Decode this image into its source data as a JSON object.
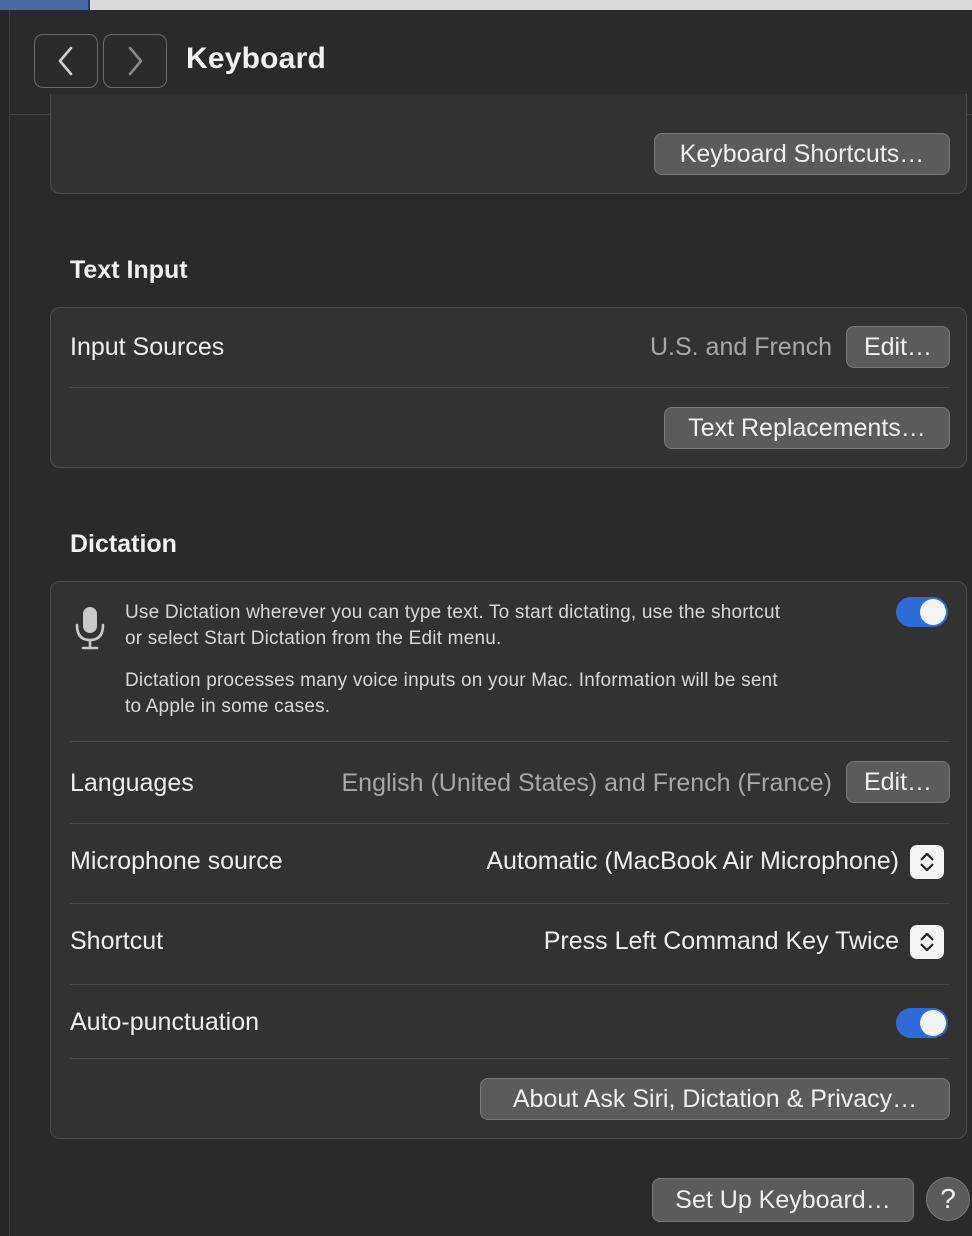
{
  "window": {
    "title": "Keyboard"
  },
  "keyboard_section": {
    "shortcuts_button": "Keyboard Shortcuts…"
  },
  "text_input": {
    "title": "Text Input",
    "input_sources_label": "Input Sources",
    "input_sources_value": "U.S. and French",
    "edit_button": "Edit…",
    "text_replacements_button": "Text Replacements…"
  },
  "dictation": {
    "title": "Dictation",
    "description_line1": "Use Dictation wherever you can type text. To start dictating, use the shortcut",
    "description_line2": "or select Start Dictation from the Edit menu.",
    "privacy_line1": "Dictation processes many voice inputs on your Mac. Information will be sent",
    "privacy_line2": "to Apple in some cases.",
    "enabled": true,
    "languages_label": "Languages",
    "languages_value": "English (United States) and French (France)",
    "languages_edit_button": "Edit…",
    "microphone_label": "Microphone source",
    "microphone_value": "Automatic (MacBook Air Microphone)",
    "shortcut_label": "Shortcut",
    "shortcut_value": "Press Left Command Key Twice",
    "autopunct_label": "Auto-punctuation",
    "autopunct_enabled": true,
    "privacy_button": "About Ask Siri, Dictation & Privacy…"
  },
  "footer": {
    "setup_button": "Set Up Keyboard…",
    "help_label": "?"
  },
  "colors": {
    "accent": "#2f6bd6",
    "background": "#2a2a2b",
    "panel": "#323233"
  },
  "icons": {
    "back": "chevron-left-icon",
    "forward": "chevron-right-icon",
    "microphone": "microphone-icon",
    "stepper": "up-down-chevron-icon"
  }
}
